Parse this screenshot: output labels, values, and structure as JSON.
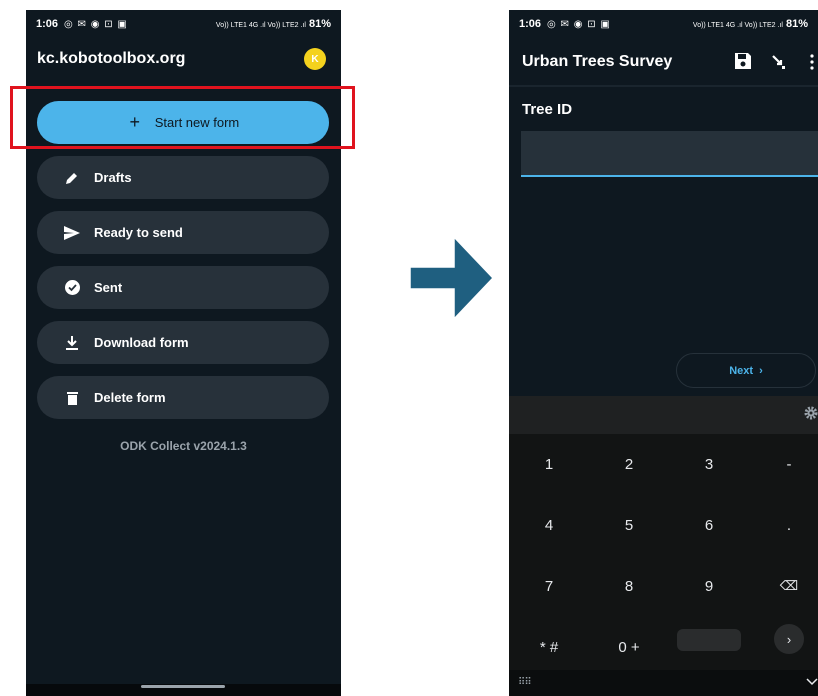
{
  "left_screen": {
    "status": {
      "time": "1:06",
      "icons": "◎ ✉ ◉ ⊡ ▣",
      "signal": "Vo)) LTE1 4G .ıl Vo)) LTE2 .ıl",
      "battery": "81%"
    },
    "server_title": "kc.kobotoolbox.org",
    "avatar_letter": "K",
    "menu": [
      {
        "label": "Start new form",
        "icon": "plus-icon"
      },
      {
        "label": "Drafts",
        "icon": "pencil-icon"
      },
      {
        "label": "Ready to send",
        "icon": "send-icon"
      },
      {
        "label": "Sent",
        "icon": "check-circle-icon"
      },
      {
        "label": "Download form",
        "icon": "download-icon"
      },
      {
        "label": "Delete form",
        "icon": "trash-icon"
      }
    ],
    "version": "ODK Collect v2024.1.3"
  },
  "right_screen": {
    "status": {
      "time": "1:06",
      "icons": "◎ ✉ ◉ ⊡ ▣",
      "signal": "Vo)) LTE1 4G .ıl Vo)) LTE2 .ıl",
      "battery": "81%"
    },
    "form_title": "Urban Trees Survey",
    "question_label": "Tree ID",
    "answer_value": "",
    "next_label": "Next",
    "keyboard": {
      "rows": [
        [
          "1",
          "2",
          "3",
          "-"
        ],
        [
          "4",
          "5",
          "6",
          "."
        ],
        [
          "7",
          "8",
          "9",
          "⌫"
        ],
        [
          "* #",
          "0 +",
          "",
          ""
        ]
      ],
      "enter_symbol": "›",
      "switch_label": "⠿⠿"
    }
  },
  "colors": {
    "accent": "#4cb4ea",
    "highlight_border": "#e0131e",
    "arrow_fill": "#1f5f80",
    "background": "#0e1820"
  }
}
